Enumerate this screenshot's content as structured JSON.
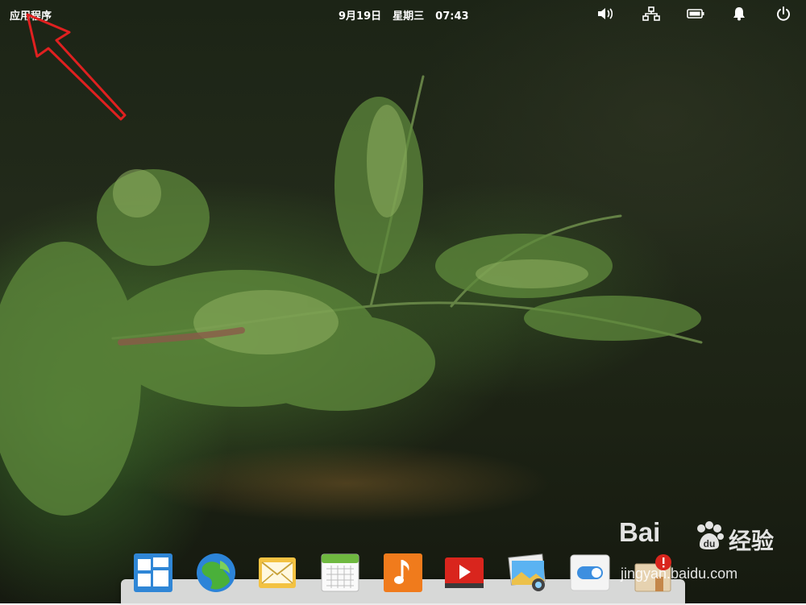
{
  "panel": {
    "applications_label": "应用程序",
    "date": "9月19日",
    "weekday": "星期三",
    "time": "07:43",
    "tray_icons": [
      "volume-icon",
      "network-icon",
      "battery-icon",
      "notification-bell-icon",
      "power-icon"
    ]
  },
  "dock": {
    "items": [
      {
        "icon": "multitasking-view-icon"
      },
      {
        "icon": "web-browser-icon"
      },
      {
        "icon": "mail-icon"
      },
      {
        "icon": "calendar-icon"
      },
      {
        "icon": "music-icon"
      },
      {
        "icon": "videos-icon"
      },
      {
        "icon": "photos-icon"
      },
      {
        "icon": "system-settings-icon"
      },
      {
        "icon": "app-center-icon"
      }
    ]
  },
  "annotation": {
    "arrow_color": "#e02020"
  },
  "watermark": {
    "brand": "Bai",
    "brand_cn": "经验",
    "url": "jingyan.baidu.com"
  },
  "colors": {
    "panel_text": "#ffffff",
    "dock_bg": "#e8e8e8",
    "accent_blue": "#3d8fe0"
  }
}
